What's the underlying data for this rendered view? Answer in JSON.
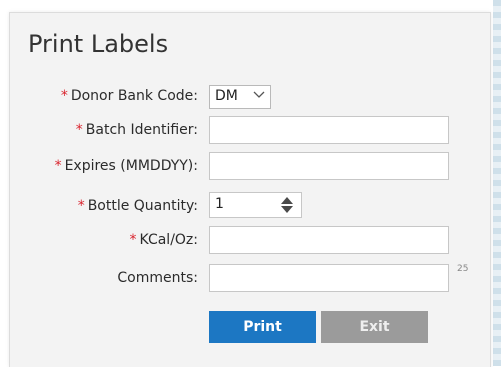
{
  "title": "Print Labels",
  "required_marker": "*",
  "fields": {
    "donor_bank_code": {
      "label": "Donor Bank Code:",
      "value": "DM"
    },
    "batch_identifier": {
      "label": "Batch Identifier:",
      "value": ""
    },
    "expires": {
      "label": "Expires (MMDDYY):",
      "value": ""
    },
    "bottle_quantity": {
      "label": "Bottle Quantity:",
      "value": "1"
    },
    "kcal_oz": {
      "label": "KCal/Oz:",
      "value": ""
    },
    "comments": {
      "label": "Comments:",
      "value": "",
      "counter": "25"
    }
  },
  "buttons": {
    "print": "Print",
    "exit": "Exit"
  },
  "icons": {
    "select_chevron": "chevron-down-icon",
    "stepper": "up-down-arrows-icon"
  },
  "colors": {
    "accent": "#1c77c3",
    "required": "#d9232d",
    "panel": "#f3f3f3",
    "exit": "#9b9b9b"
  }
}
